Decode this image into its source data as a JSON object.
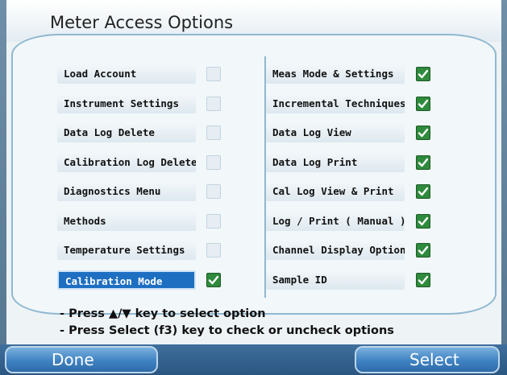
{
  "title": "Meter Access Options",
  "left_options": [
    {
      "label": "Load Account",
      "checked": false,
      "selected": false
    },
    {
      "label": "Instrument Settings",
      "checked": false,
      "selected": false
    },
    {
      "label": "Data Log Delete",
      "checked": false,
      "selected": false
    },
    {
      "label": "Calibration Log Delete",
      "checked": false,
      "selected": false
    },
    {
      "label": "Diagnostics Menu",
      "checked": false,
      "selected": false
    },
    {
      "label": "Methods",
      "checked": false,
      "selected": false
    },
    {
      "label": "Temperature Settings",
      "checked": false,
      "selected": false
    },
    {
      "label": "Calibration Mode",
      "checked": true,
      "selected": true
    }
  ],
  "right_options": [
    {
      "label": "Meas Mode & Settings",
      "checked": true,
      "selected": false
    },
    {
      "label": "Incremental Techniques",
      "checked": true,
      "selected": false
    },
    {
      "label": "Data Log View",
      "checked": true,
      "selected": false
    },
    {
      "label": "Data Log Print",
      "checked": true,
      "selected": false
    },
    {
      "label": "Cal Log View & Print",
      "checked": true,
      "selected": false
    },
    {
      "label": "Log / Print ( Manual )",
      "checked": true,
      "selected": false
    },
    {
      "label": "Channel Display Option",
      "checked": true,
      "selected": false
    },
    {
      "label": "Sample ID",
      "checked": true,
      "selected": false
    }
  ],
  "help": {
    "line1": "- Press ▲/▼ key to select option",
    "line2": "- Press Select (f3) key to check or uncheck options"
  },
  "buttons": {
    "done": "Done",
    "select": "Select"
  },
  "colors": {
    "accent": "#1e6fc2",
    "check": "#2e8a3c"
  }
}
